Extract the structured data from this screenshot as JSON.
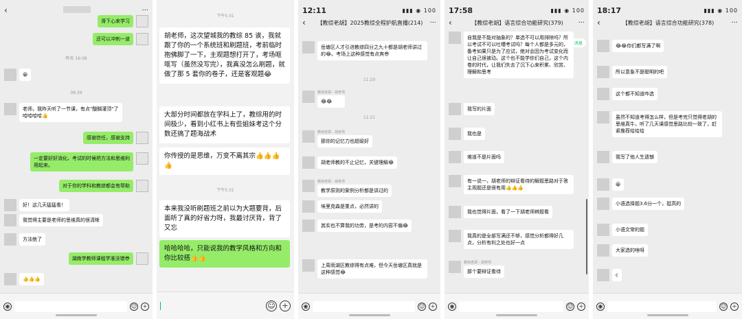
{
  "p1": {
    "title": "",
    "messages": [
      {
        "side": "right",
        "text": "滑下心来学习"
      },
      {
        "side": "right",
        "text": "还可以冲刺一波"
      },
      {
        "type": "ts",
        "text": "昨天 16:08"
      },
      {
        "side": "left",
        "text": "😀"
      },
      {
        "type": "ts",
        "text": "09:39"
      },
      {
        "side": "left",
        "text": "老师，我昨天听了一节课，有点\"醍醐灌顶\"了哈哈哈哈👍"
      },
      {
        "side": "right",
        "text": "感谢信任，感谢支持"
      },
      {
        "side": "right",
        "text": "一定要好好消化，考试的时候把方法和思维利用起来。"
      },
      {
        "side": "right",
        "text": "对于你的学科和教综都会有帮助"
      },
      {
        "side": "left",
        "text": "好！这几天猛猛看！"
      },
      {
        "side": "left",
        "text": "我觉得主要是老师的思维真的很清晰"
      },
      {
        "side": "left",
        "text": "方法绝了"
      },
      {
        "side": "right",
        "text": "湖南学教师课程学准没错😎"
      },
      {
        "side": "left",
        "text": "👍👍👍"
      }
    ]
  },
  "p2": {
    "ts1": "下午5:31",
    "m1": "胡老师，这次望城我的教综 85 诶，我就跟了你的一个系统班和刷题班，考前临时抱佛脚了一下，主观题想打开了，考场哐哐写（虽然没写完），我真没怎么刷题，就做了那 5 套你的卷子，还是客观题😂",
    "m2": "大部分时间都放在学科上了，教综用的时间极少，看到小红书上有些姐妹考这个分数还搞了题海战术",
    "m3": "你传授的是思维，万变不离其宗👍👍👍👍",
    "ts2": "下午5:31",
    "m4": "本来我没听刷题班之前以为大题要背，后面听了真的好省力呀，我最讨厌背，背了又忘",
    "m5": "哈哈哈哈，只能说我的教学风格和方向和你比较搭👍👍"
  },
  "p3": {
    "time": "12:11",
    "title": "【教综老胡】2025教综全程护航直播(214)",
    "messages": [
      {
        "side": "left",
        "text": "岳塘区人才引进教综四分之九十都是胡老师讲过的😂。考场上这种感觉有点爽😎"
      },
      {
        "type": "ts",
        "text": "11:20"
      },
      {
        "side": "left",
        "sender": "教综老胡 - 胡老师",
        "text": "😂😂"
      },
      {
        "type": "ts",
        "text": "11:21"
      },
      {
        "side": "left",
        "sender": "教综老胡 - 胡老师",
        "text": "那你的记忆力也超级好"
      },
      {
        "side": "left",
        "text": "胡老师教的不止记忆，关键理解😂"
      },
      {
        "side": "left",
        "sender": "教综老胡 - 胡老师",
        "text": "教学原则的案例分析都是讲过的"
      },
      {
        "side": "left",
        "text": "埃里克森是重点，必然讲的"
      },
      {
        "side": "left",
        "text": "其实也不算我的功劳，是考的内容不偏😂"
      },
      {
        "side": "left",
        "text": "上周雨湖区教综得有点难，但今天岳塘区真就是这种感觉😂"
      }
    ]
  },
  "p4": {
    "time": "17:58",
    "title": "【教综老胡】语言综合功能研究(379)",
    "newmsg": "62条新消息",
    "messages": [
      {
        "side": "left",
        "text": "自我是不能对抽象的？单选不可以用排除吗？所以考试不可以吐槽考试吗？每个人都是多元的，备考如果只是为了应试，绝对会因为考试变化而让自己很被动。这个也不能学你们自己，这个内卷的时代，让我们失去了沉下心来积累、欣赏、理解和思考"
      },
      {
        "side": "left",
        "text": "我写的片面"
      },
      {
        "side": "left",
        "text": "我也是"
      },
      {
        "side": "left",
        "text": "难道不是片面吗"
      },
      {
        "side": "left",
        "text": "有一说一，胡老师的辩证看待的解题思路对于答主观题还是很有用👍👍👍"
      },
      {
        "side": "left",
        "text": "我也觉得片面，看了一下胡老师辨题看"
      },
      {
        "side": "left",
        "text": "我真的是全部写满还不够，感觉分析都得好几点，分析有利之处也好一点"
      },
      {
        "side": "left",
        "sender": "教综老胡 - 胡老师",
        "text": "那个要辩证看待"
      }
    ]
  },
  "p5": {
    "time": "18:17",
    "title": "【教综老胡】语言综合功能研究(378)",
    "messages": [
      {
        "side": "left",
        "text": "😂😂你们都写满了啊"
      },
      {
        "side": "left",
        "text": "所以意象不是聪明的吧"
      },
      {
        "side": "left",
        "text": "这个都不知道咋选"
      },
      {
        "side": "left",
        "text": "虽然不知道考得怎么样，但是考完只觉得老胡的思维真牛，听了几天课感觉思路比较一致了，赶紧推荐给给给"
      },
      {
        "side": "left",
        "text": "我写了他人生遗憾"
      },
      {
        "side": "left",
        "text": "😀"
      },
      {
        "side": "left",
        "text": "小语选择题3.6分一个，挺高的"
      },
      {
        "side": "left",
        "text": "小语文常的题"
      },
      {
        "side": "left",
        "text": "大家选的啥呀"
      },
      {
        "side": "left",
        "text": "c"
      }
    ]
  },
  "status": {
    "icons": "▮▮▮ ◉ 100"
  }
}
